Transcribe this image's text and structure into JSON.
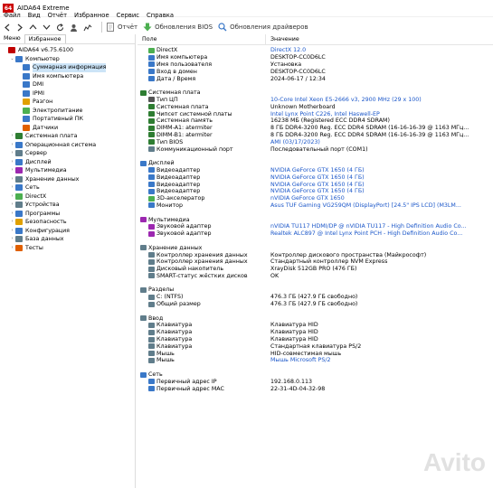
{
  "window": {
    "title": "AIDA64 Extreme",
    "logo": "64"
  },
  "menu": [
    "Файл",
    "Вид",
    "Отчёт",
    "Избранное",
    "Сервис",
    "Справка"
  ],
  "toolbar": {
    "report": "Отчёт",
    "bios": "Обновления BIOS",
    "drivers": "Обновления драйверов"
  },
  "tabs": {
    "menu": "Меню",
    "favorites": "Избранное"
  },
  "tree": [
    {
      "label": "AIDA64 v6.75.6100",
      "level": 0,
      "exp": "",
      "color": "#c00000"
    },
    {
      "label": "Компьютер",
      "level": 1,
      "exp": "⌄",
      "color": "#3a78c8"
    },
    {
      "label": "Суммарная информация",
      "level": 2,
      "exp": "",
      "color": "#3a78c8",
      "selected": true
    },
    {
      "label": "Имя компьютера",
      "level": 2,
      "exp": "",
      "color": "#3a78c8"
    },
    {
      "label": "DMI",
      "level": 2,
      "exp": "",
      "color": "#3a78c8"
    },
    {
      "label": "IPMI",
      "level": 2,
      "exp": "",
      "color": "#3a78c8"
    },
    {
      "label": "Разгон",
      "level": 2,
      "exp": "",
      "color": "#e0a000"
    },
    {
      "label": "Электропитание",
      "level": 2,
      "exp": "",
      "color": "#4caf50"
    },
    {
      "label": "Портативный ПК",
      "level": 2,
      "exp": "",
      "color": "#3a78c8"
    },
    {
      "label": "Датчики",
      "level": 2,
      "exp": "",
      "color": "#e06000"
    },
    {
      "label": "Системная плата",
      "level": 1,
      "exp": "›",
      "color": "#2e7d32"
    },
    {
      "label": "Операционная система",
      "level": 1,
      "exp": "›",
      "color": "#3a78c8"
    },
    {
      "label": "Сервер",
      "level": 1,
      "exp": "›",
      "color": "#607d8b"
    },
    {
      "label": "Дисплей",
      "level": 1,
      "exp": "›",
      "color": "#3a78c8"
    },
    {
      "label": "Мультимедиа",
      "level": 1,
      "exp": "›",
      "color": "#9c27b0"
    },
    {
      "label": "Хранение данных",
      "level": 1,
      "exp": "›",
      "color": "#607d8b"
    },
    {
      "label": "Сеть",
      "level": 1,
      "exp": "›",
      "color": "#3a78c8"
    },
    {
      "label": "DirectX",
      "level": 1,
      "exp": "›",
      "color": "#4caf50"
    },
    {
      "label": "Устройства",
      "level": 1,
      "exp": "›",
      "color": "#607d8b"
    },
    {
      "label": "Программы",
      "level": 1,
      "exp": "›",
      "color": "#3a78c8"
    },
    {
      "label": "Безопасность",
      "level": 1,
      "exp": "›",
      "color": "#e0a000"
    },
    {
      "label": "Конфигурация",
      "level": 1,
      "exp": "›",
      "color": "#3a78c8"
    },
    {
      "label": "База данных",
      "level": 1,
      "exp": "›",
      "color": "#607d8b"
    },
    {
      "label": "Тесты",
      "level": 1,
      "exp": "›",
      "color": "#e06000"
    }
  ],
  "columns": {
    "field": "Поле",
    "value": "Значение"
  },
  "rows": [
    {
      "t": "item",
      "f": "DirectX",
      "v": "DirectX 12.0",
      "link": true,
      "color": "#4caf50"
    },
    {
      "t": "item",
      "f": "Имя компьютера",
      "v": "DESKTOP-CC0D6LC",
      "color": "#3a78c8"
    },
    {
      "t": "item",
      "f": "Имя пользователя",
      "v": "Установка",
      "color": "#3a78c8"
    },
    {
      "t": "item",
      "f": "Вход в домен",
      "v": "DESKTOP-CC0D6LC",
      "color": "#3a78c8"
    },
    {
      "t": "item",
      "f": "Дата / Время",
      "v": "2024-06-17 / 12:34",
      "color": "#3a78c8"
    },
    {
      "t": "gap"
    },
    {
      "t": "section",
      "f": "Системная плата",
      "color": "#2e7d32"
    },
    {
      "t": "item",
      "f": "Тип ЦП",
      "v": "10-Core Intel Xeon E5-2666 v3, 2900 MHz (29 x 100)",
      "link": true,
      "color": "#555"
    },
    {
      "t": "item",
      "f": "Системная плата",
      "v": "Unknown Motherboard",
      "color": "#2e7d32"
    },
    {
      "t": "item",
      "f": "Чипсет системной платы",
      "v": "Intel Lynx Point C226, Intel Haswell-EP",
      "link": true,
      "color": "#2e7d32"
    },
    {
      "t": "item",
      "f": "Системная память",
      "v": "16238 МБ  (Registered ECC DDR4 SDRAM)",
      "color": "#2e7d32"
    },
    {
      "t": "item",
      "f": "DIMM-A1: atermiter",
      "v": "8 ГБ DDR4-3200 Reg. ECC DDR4 SDRAM  (16-16-16-39 @ 1163 МГц...",
      "color": "#2e7d32"
    },
    {
      "t": "item",
      "f": "DIMM-B1: atermiter",
      "v": "8 ГБ DDR4-3200 Reg. ECC DDR4 SDRAM  (16-16-16-39 @ 1163 МГц...",
      "color": "#2e7d32"
    },
    {
      "t": "item",
      "f": "Тип BIOS",
      "v": "AMI (03/17/2023)",
      "link": true,
      "color": "#2e7d32"
    },
    {
      "t": "item",
      "f": "Коммуникационный порт",
      "v": "Последовательный порт (COM1)",
      "color": "#607d8b"
    },
    {
      "t": "gap"
    },
    {
      "t": "section",
      "f": "Дисплей",
      "color": "#3a78c8"
    },
    {
      "t": "item",
      "f": "Видеоадаптер",
      "v": "NVIDIA GeForce GTX 1650  (4 ГБ)",
      "link": true,
      "color": "#3a78c8"
    },
    {
      "t": "item",
      "f": "Видеоадаптер",
      "v": "NVIDIA GeForce GTX 1650  (4 ГБ)",
      "link": true,
      "color": "#3a78c8"
    },
    {
      "t": "item",
      "f": "Видеоадаптер",
      "v": "NVIDIA GeForce GTX 1650  (4 ГБ)",
      "link": true,
      "color": "#3a78c8"
    },
    {
      "t": "item",
      "f": "Видеоадаптер",
      "v": "NVIDIA GeForce GTX 1650  (4 ГБ)",
      "link": true,
      "color": "#3a78c8"
    },
    {
      "t": "item",
      "f": "3D-акселератор",
      "v": "nVIDIA GeForce GTX 1650",
      "link": true,
      "color": "#4caf50"
    },
    {
      "t": "item",
      "f": "Монитор",
      "v": "Asus TUF Gaming VG259QM (DisplayPort)  [24.5\" IPS LCD]  (M3LM...",
      "link": true,
      "color": "#3a78c8"
    },
    {
      "t": "gap"
    },
    {
      "t": "section",
      "f": "Мультимедиа",
      "color": "#9c27b0"
    },
    {
      "t": "item",
      "f": "Звуковой адаптер",
      "v": "nVIDIA TU117 HDMI/DP @ nVIDIA TU117 - High Definition Audio Co...",
      "link": true,
      "color": "#9c27b0"
    },
    {
      "t": "item",
      "f": "Звуковой адаптер",
      "v": "Realtek ALC897 @ Intel Lynx Point PCH - High Definition Audio Co...",
      "link": true,
      "color": "#9c27b0"
    },
    {
      "t": "gap"
    },
    {
      "t": "section",
      "f": "Хранение данных",
      "color": "#607d8b"
    },
    {
      "t": "item",
      "f": "Контроллер хранения данных",
      "v": "Контроллер дискового пространства (Майкрософт)",
      "color": "#607d8b"
    },
    {
      "t": "item",
      "f": "Контроллер хранения данных",
      "v": "Стандартный контроллер NVM Express",
      "color": "#607d8b"
    },
    {
      "t": "item",
      "f": "Дисковый накопитель",
      "v": "XrayDisk 512GB PRO  (476 ГБ)",
      "color": "#607d8b"
    },
    {
      "t": "item",
      "f": "SMART-статус жёстких дисков",
      "v": "OK",
      "color": "#607d8b"
    },
    {
      "t": "gap"
    },
    {
      "t": "section",
      "f": "Разделы",
      "color": "#607d8b"
    },
    {
      "t": "item",
      "f": "C: (NTFS)",
      "v": "476.3 ГБ (427.9 ГБ свободно)",
      "color": "#607d8b"
    },
    {
      "t": "item",
      "f": "Общий размер",
      "v": "476.3 ГБ (427.9 ГБ свободно)",
      "color": "#607d8b"
    },
    {
      "t": "gap"
    },
    {
      "t": "section",
      "f": "Ввод",
      "color": "#607d8b"
    },
    {
      "t": "item",
      "f": "Клавиатура",
      "v": "Клавиатура HID",
      "color": "#607d8b"
    },
    {
      "t": "item",
      "f": "Клавиатура",
      "v": "Клавиатура HID",
      "color": "#607d8b"
    },
    {
      "t": "item",
      "f": "Клавиатура",
      "v": "Клавиатура HID",
      "color": "#607d8b"
    },
    {
      "t": "item",
      "f": "Клавиатура",
      "v": "Стандартная клавиатура PS/2",
      "color": "#607d8b"
    },
    {
      "t": "item",
      "f": "Мышь",
      "v": "HID-совместимая мышь",
      "color": "#607d8b"
    },
    {
      "t": "item",
      "f": "Мышь",
      "v": "Мышь Microsoft PS/2",
      "link": true,
      "color": "#607d8b"
    },
    {
      "t": "gap"
    },
    {
      "t": "section",
      "f": "Сеть",
      "color": "#3a78c8"
    },
    {
      "t": "item",
      "f": "Первичный адрес IP",
      "v": "192.168.0.113",
      "color": "#3a78c8"
    },
    {
      "t": "item",
      "f": "Первичный адрес MAC",
      "v": "22-31-4D-04-32-98",
      "color": "#3a78c8"
    }
  ],
  "watermark": "Avito"
}
